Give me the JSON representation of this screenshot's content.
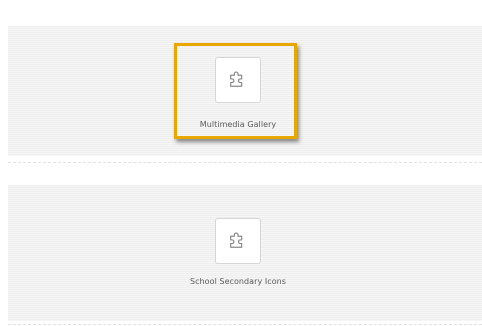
{
  "modules": [
    {
      "label": "Multimedia Gallery",
      "icon": "puzzle-piece-icon",
      "highlighted": true
    },
    {
      "label": "School Secondary Icons",
      "icon": "puzzle-piece-icon",
      "highlighted": false
    }
  ],
  "colors": {
    "panel_background": "#f1f1f1",
    "highlight_border": "#e8a800",
    "label_text": "#5a5a5a",
    "icon_stroke": "#8a8a8a"
  }
}
